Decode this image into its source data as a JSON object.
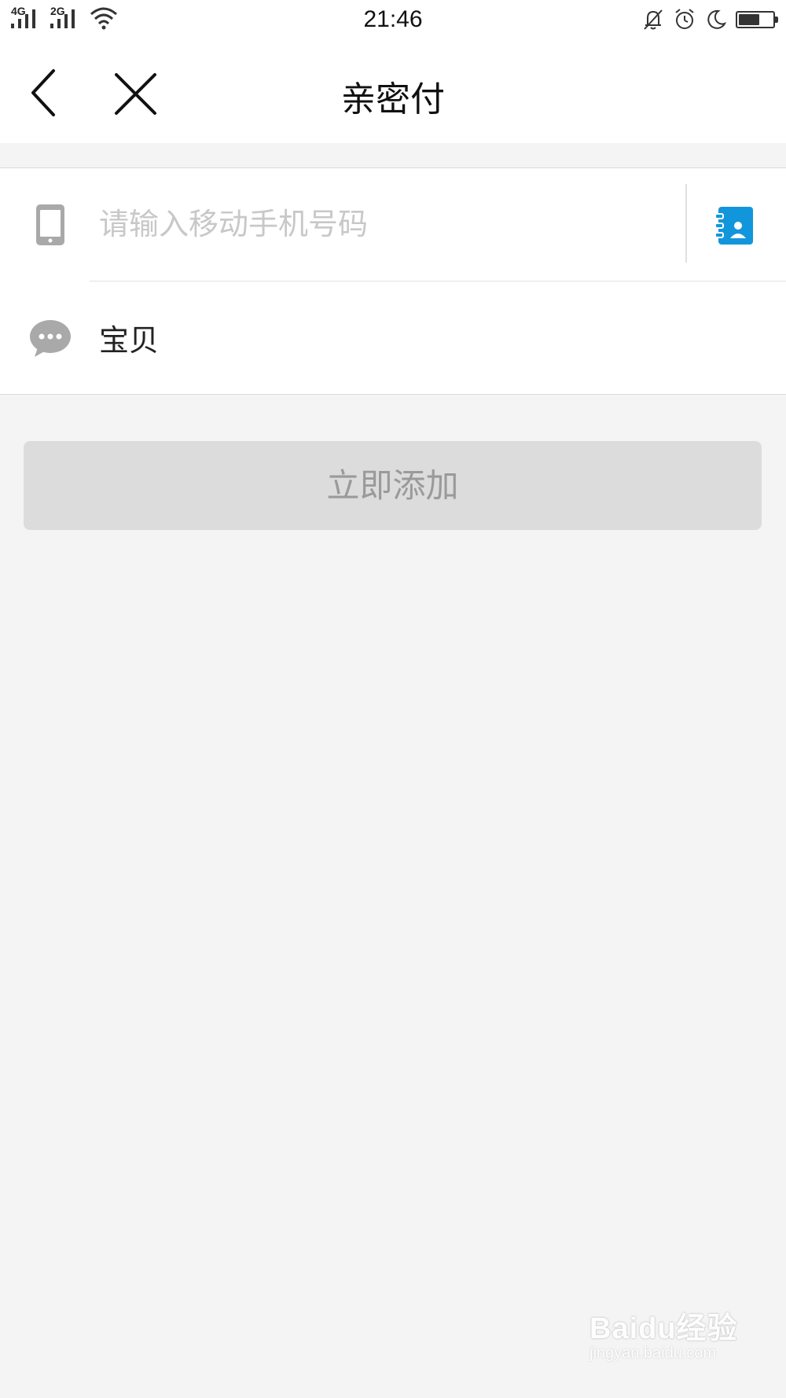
{
  "status_bar": {
    "time": "21:46",
    "network_1": "4G",
    "network_2": "2G",
    "battery_level": 0.65,
    "icons": [
      "signal-icon",
      "wifi-icon",
      "mute-bell-icon",
      "alarm-icon",
      "moon-icon",
      "battery-icon"
    ]
  },
  "nav": {
    "title": "亲密付",
    "back_icon": "chevron-left-icon",
    "close_icon": "close-icon"
  },
  "form": {
    "phone": {
      "placeholder": "请输入移动手机号码",
      "value": "",
      "icon": "phone-icon",
      "contacts_icon": "contacts-book-icon",
      "contacts_color": "#1296db"
    },
    "message": {
      "value": "宝贝",
      "icon": "chat-bubble-icon"
    }
  },
  "add_button": {
    "label": "立即添加"
  },
  "watermark": {
    "brand": "Baidu经验",
    "url": "jingyan.baidu.com"
  }
}
